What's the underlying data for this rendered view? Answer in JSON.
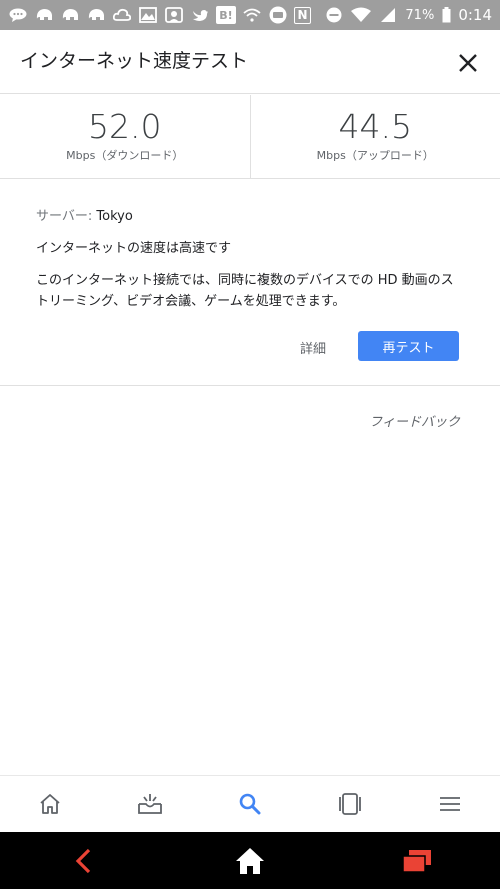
{
  "status_bar": {
    "battery": "71%",
    "time": "0:14",
    "badge_b": "B!",
    "badge_n": "N",
    "icons": [
      "chat-bubble-icon",
      "elephant-icon",
      "elephant-icon",
      "elephant-icon",
      "cloud-icon",
      "gallery-icon",
      "sticker-icon",
      "twitter-bird-icon",
      "b-badge-icon",
      "wifi-icon",
      "whitespace-chat-icon",
      "nfc-icon",
      "do-not-disturb-icon",
      "wifi-icon",
      "signal-icon",
      "battery-icon"
    ]
  },
  "header": {
    "title": "インターネット速度テスト"
  },
  "speeds": {
    "download": {
      "value": "52.0",
      "unit": "Mbps（ダウンロード）"
    },
    "upload": {
      "value": "44.5",
      "unit": "Mbps（アップロード）"
    }
  },
  "result": {
    "server_label": "サーバー: ",
    "server_value": "Tokyo",
    "headline": "インターネットの速度は高速です",
    "description": "このインターネット接続では、同時に複数のデバイスでの HD 動画のストリーミング、ビデオ会議、ゲームを処理できます。",
    "details_label": "詳細",
    "retest_label": "再テスト"
  },
  "feedback_label": "フィードバック",
  "bottom_nav": {
    "items": [
      "home-icon",
      "inbox-icon",
      "search-icon",
      "tabs-icon",
      "menu-icon"
    ],
    "active": "search-icon"
  },
  "colors": {
    "accent": "#4285f4",
    "status_bar": "#9e9e9e",
    "system_back": "#ea4335",
    "system_recent": "#ea4335"
  }
}
